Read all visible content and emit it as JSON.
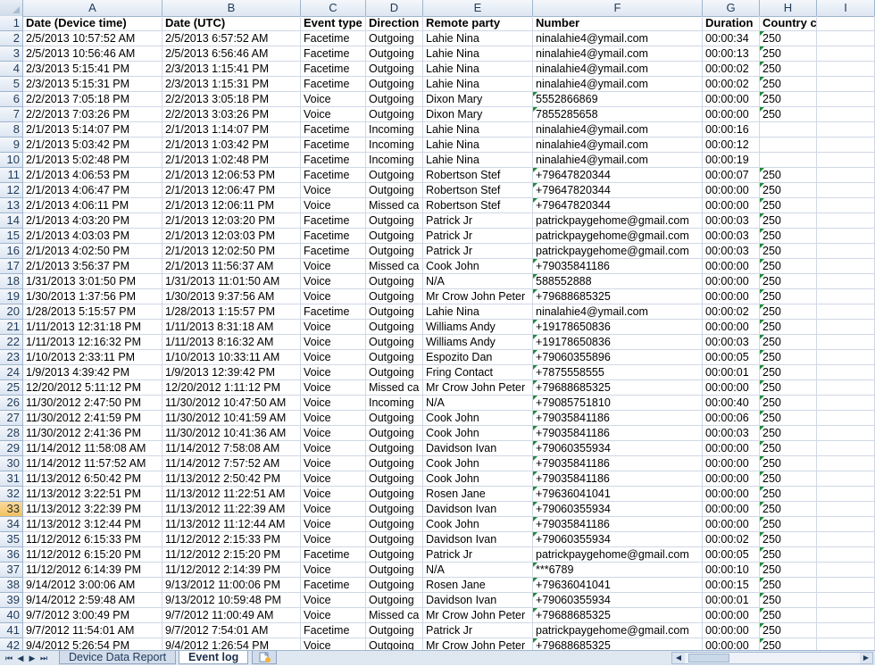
{
  "columns": [
    "A",
    "B",
    "C",
    "D",
    "E",
    "F",
    "G",
    "H",
    "I"
  ],
  "rows": [
    [
      "1",
      "Date (Device time)",
      "Date (UTC)",
      "Event type",
      "Direction",
      "Remote party",
      "Number",
      "Duration",
      "Country code",
      ""
    ],
    [
      "2",
      "2/5/2013 10:57:52 AM",
      "2/5/2013 6:57:52 AM",
      "Facetime",
      "Outgoing",
      "Lahie Nina",
      "ninalahie4@ymail.com",
      "00:00:34",
      "250",
      ""
    ],
    [
      "3",
      "2/5/2013 10:56:46 AM",
      "2/5/2013 6:56:46 AM",
      "Facetime",
      "Outgoing",
      "Lahie Nina",
      "ninalahie4@ymail.com",
      "00:00:13",
      "250",
      ""
    ],
    [
      "4",
      "2/3/2013 5:15:41 PM",
      "2/3/2013 1:15:41 PM",
      "Facetime",
      "Outgoing",
      "Lahie Nina",
      "ninalahie4@ymail.com",
      "00:00:02",
      "250",
      ""
    ],
    [
      "5",
      "2/3/2013 5:15:31 PM",
      "2/3/2013 1:15:31 PM",
      "Facetime",
      "Outgoing",
      "Lahie Nina",
      "ninalahie4@ymail.com",
      "00:00:02",
      "250",
      ""
    ],
    [
      "6",
      "2/2/2013 7:05:18 PM",
      "2/2/2013 3:05:18 PM",
      "Voice",
      "Outgoing",
      "Dixon Mary",
      "5552866869",
      "00:00:00",
      "250",
      ""
    ],
    [
      "7",
      "2/2/2013 7:03:26 PM",
      "2/2/2013 3:03:26 PM",
      "Voice",
      "Outgoing",
      "Dixon Mary",
      "7855285658",
      "00:00:00",
      "250",
      ""
    ],
    [
      "8",
      "2/1/2013 5:14:07 PM",
      "2/1/2013 1:14:07 PM",
      "Facetime",
      "Incoming",
      "Lahie Nina",
      "ninalahie4@ymail.com",
      "00:00:16",
      "",
      ""
    ],
    [
      "9",
      "2/1/2013 5:03:42 PM",
      "2/1/2013 1:03:42 PM",
      "Facetime",
      "Incoming",
      "Lahie Nina",
      "ninalahie4@ymail.com",
      "00:00:12",
      "",
      ""
    ],
    [
      "10",
      "2/1/2013 5:02:48 PM",
      "2/1/2013 1:02:48 PM",
      "Facetime",
      "Incoming",
      "Lahie Nina",
      "ninalahie4@ymail.com",
      "00:00:19",
      "",
      ""
    ],
    [
      "11",
      "2/1/2013 4:06:53 PM",
      "2/1/2013 12:06:53 PM",
      "Facetime",
      "Outgoing",
      "Robertson Stef",
      "+79647820344",
      "00:00:07",
      "250",
      ""
    ],
    [
      "12",
      "2/1/2013 4:06:47 PM",
      "2/1/2013 12:06:47 PM",
      "Voice",
      "Outgoing",
      "Robertson Stef",
      "+79647820344",
      "00:00:00",
      "250",
      ""
    ],
    [
      "13",
      "2/1/2013 4:06:11 PM",
      "2/1/2013 12:06:11 PM",
      "Voice",
      "Missed ca",
      "Robertson Stef",
      "+79647820344",
      "00:00:00",
      "250",
      ""
    ],
    [
      "14",
      "2/1/2013 4:03:20 PM",
      "2/1/2013 12:03:20 PM",
      "Facetime",
      "Outgoing",
      "Patrick Jr",
      "patrickpaygehome@gmail.com",
      "00:00:03",
      "250",
      ""
    ],
    [
      "15",
      "2/1/2013 4:03:03 PM",
      "2/1/2013 12:03:03 PM",
      "Facetime",
      "Outgoing",
      "Patrick Jr",
      "patrickpaygehome@gmail.com",
      "00:00:03",
      "250",
      ""
    ],
    [
      "16",
      "2/1/2013 4:02:50 PM",
      "2/1/2013 12:02:50 PM",
      "Facetime",
      "Outgoing",
      "Patrick Jr",
      "patrickpaygehome@gmail.com",
      "00:00:03",
      "250",
      ""
    ],
    [
      "17",
      "2/1/2013 3:56:37 PM",
      "2/1/2013 11:56:37 AM",
      "Voice",
      "Missed ca",
      "Cook John",
      "+79035841186",
      "00:00:00",
      "250",
      ""
    ],
    [
      "18",
      "1/31/2013 3:01:50 PM",
      "1/31/2013 11:01:50 AM",
      "Voice",
      "Outgoing",
      "N/A",
      "588552888",
      "00:00:00",
      "250",
      ""
    ],
    [
      "19",
      "1/30/2013 1:37:56 PM",
      "1/30/2013 9:37:56 AM",
      "Voice",
      "Outgoing",
      "Mr Crow John Peter",
      "+79688685325",
      "00:00:00",
      "250",
      ""
    ],
    [
      "20",
      "1/28/2013 5:15:57 PM",
      "1/28/2013 1:15:57 PM",
      "Facetime",
      "Outgoing",
      "Lahie Nina",
      "ninalahie4@ymail.com",
      "00:00:02",
      "250",
      ""
    ],
    [
      "21",
      "1/11/2013 12:31:18 PM",
      "1/11/2013 8:31:18 AM",
      "Voice",
      "Outgoing",
      "Williams Andy",
      "+19178650836",
      "00:00:00",
      "250",
      ""
    ],
    [
      "22",
      "1/11/2013 12:16:32 PM",
      "1/11/2013 8:16:32 AM",
      "Voice",
      "Outgoing",
      "Williams Andy",
      "+19178650836",
      "00:00:03",
      "250",
      ""
    ],
    [
      "23",
      "1/10/2013 2:33:11 PM",
      "1/10/2013 10:33:11 AM",
      "Voice",
      "Outgoing",
      "Espozito Dan",
      "+79060355896",
      "00:00:05",
      "250",
      ""
    ],
    [
      "24",
      "1/9/2013 4:39:42 PM",
      "1/9/2013 12:39:42 PM",
      "Voice",
      "Outgoing",
      "Fring Contact",
      "+7875558555",
      "00:00:01",
      "250",
      ""
    ],
    [
      "25",
      "12/20/2012 5:11:12 PM",
      "12/20/2012 1:11:12 PM",
      "Voice",
      "Missed ca",
      "Mr Crow John Peter",
      "+79688685325",
      "00:00:00",
      "250",
      ""
    ],
    [
      "26",
      "11/30/2012 2:47:50 PM",
      "11/30/2012 10:47:50 AM",
      "Voice",
      "Incoming",
      "N/A",
      "+79085751810",
      "00:00:40",
      "250",
      ""
    ],
    [
      "27",
      "11/30/2012 2:41:59 PM",
      "11/30/2012 10:41:59 AM",
      "Voice",
      "Outgoing",
      "Cook John",
      "+79035841186",
      "00:00:06",
      "250",
      ""
    ],
    [
      "28",
      "11/30/2012 2:41:36 PM",
      "11/30/2012 10:41:36 AM",
      "Voice",
      "Outgoing",
      "Cook John",
      "+79035841186",
      "00:00:03",
      "250",
      ""
    ],
    [
      "29",
      "11/14/2012 11:58:08 AM",
      "11/14/2012 7:58:08 AM",
      "Voice",
      "Outgoing",
      "Davidson Ivan",
      "+79060355934",
      "00:00:00",
      "250",
      ""
    ],
    [
      "30",
      "11/14/2012 11:57:52 AM",
      "11/14/2012 7:57:52 AM",
      "Voice",
      "Outgoing",
      "Cook John",
      "+79035841186",
      "00:00:00",
      "250",
      ""
    ],
    [
      "31",
      "11/13/2012 6:50:42 PM",
      "11/13/2012 2:50:42 PM",
      "Voice",
      "Outgoing",
      "Cook John",
      "+79035841186",
      "00:00:00",
      "250",
      ""
    ],
    [
      "32",
      "11/13/2012 3:22:51 PM",
      "11/13/2012 11:22:51 AM",
      "Voice",
      "Outgoing",
      "Rosen Jane",
      "+79636041041",
      "00:00:00",
      "250",
      ""
    ],
    [
      "33",
      "11/13/2012 3:22:39 PM",
      "11/13/2012 11:22:39 AM",
      "Voice",
      "Outgoing",
      "Davidson Ivan",
      "+79060355934",
      "00:00:00",
      "250",
      ""
    ],
    [
      "34",
      "11/13/2012 3:12:44 PM",
      "11/13/2012 11:12:44 AM",
      "Voice",
      "Outgoing",
      "Cook John",
      "+79035841186",
      "00:00:00",
      "250",
      ""
    ],
    [
      "35",
      "11/12/2012 6:15:33 PM",
      "11/12/2012 2:15:33 PM",
      "Voice",
      "Outgoing",
      "Davidson Ivan",
      "+79060355934",
      "00:00:02",
      "250",
      ""
    ],
    [
      "36",
      "11/12/2012 6:15:20 PM",
      "11/12/2012 2:15:20 PM",
      "Facetime",
      "Outgoing",
      "Patrick Jr",
      "patrickpaygehome@gmail.com",
      "00:00:05",
      "250",
      ""
    ],
    [
      "37",
      "11/12/2012 6:14:39 PM",
      "11/12/2012 2:14:39 PM",
      "Voice",
      "Outgoing",
      "N/A",
      "***6789",
      "00:00:10",
      "250",
      ""
    ],
    [
      "38",
      "9/14/2012 3:00:06 AM",
      "9/13/2012 11:00:06 PM",
      "Facetime",
      "Outgoing",
      "Rosen Jane",
      "+79636041041",
      "00:00:15",
      "250",
      ""
    ],
    [
      "39",
      "9/14/2012 2:59:48 AM",
      "9/13/2012 10:59:48 PM",
      "Voice",
      "Outgoing",
      "Davidson Ivan",
      "+79060355934",
      "00:00:01",
      "250",
      ""
    ],
    [
      "40",
      "9/7/2012 3:00:49 PM",
      "9/7/2012 11:00:49 AM",
      "Voice",
      "Missed ca",
      "Mr Crow John Peter",
      "+79688685325",
      "00:00:00",
      "250",
      ""
    ],
    [
      "41",
      "9/7/2012 11:54:01 AM",
      "9/7/2012 7:54:01 AM",
      "Facetime",
      "Outgoing",
      "Patrick Jr",
      "patrickpaygehome@gmail.com",
      "00:00:00",
      "250",
      ""
    ],
    [
      "42",
      "9/4/2012 5:26:54 PM",
      "9/4/2012 1:26:54 PM",
      "Voice",
      "Outgoing",
      "Mr Crow John Peter",
      "+79688685325",
      "00:00:00",
      "250",
      ""
    ]
  ],
  "active_row": "33",
  "tabs": {
    "first_label": "Device Data Report",
    "second_label": "Event log"
  },
  "nav_glyphs": {
    "first": "⏮",
    "prev": "◀",
    "next": "▶",
    "last": "⏭",
    "scroll_left": "◀",
    "scroll_right": "▶"
  },
  "icons": {
    "new_sheet": "new-sheet-icon"
  },
  "colors": {
    "header_bg": "#dde6f2",
    "grid_line": "#d0d7e5",
    "comment_triangle": "#1e8a3a",
    "active_row_header": "#f1c15f"
  }
}
